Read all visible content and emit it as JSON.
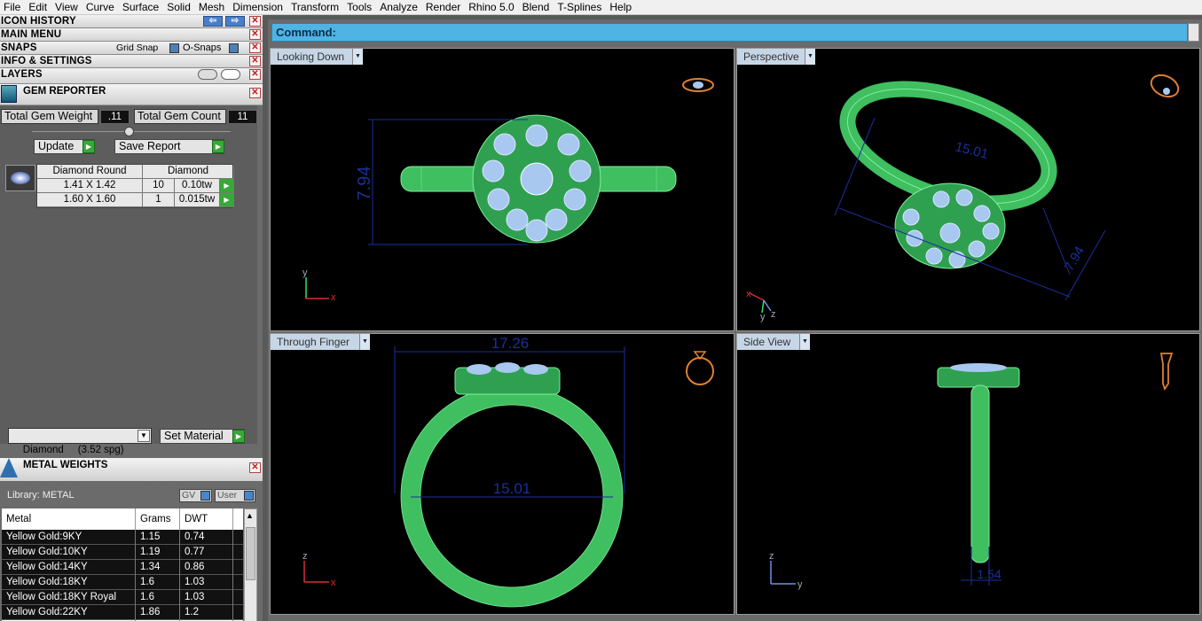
{
  "menu": [
    "File",
    "Edit",
    "View",
    "Curve",
    "Surface",
    "Solid",
    "Mesh",
    "Dimension",
    "Transform",
    "Tools",
    "Analyze",
    "Render",
    "Rhino 5.0",
    "Blend",
    "T-Splines",
    "Help"
  ],
  "panels": {
    "icon_history": "ICON HISTORY",
    "main_menu": "MAIN MENU",
    "snaps": "SNAPS",
    "grid_snap": "Grid Snap",
    "o_snaps": "O-Snaps",
    "info_settings": "INFO & SETTINGS",
    "layers": "LAYERS",
    "close_glyph": "✕",
    "left_arrow": "⇦",
    "right_arrow": "⇨"
  },
  "gem_reporter": {
    "title": "GEM REPORTER",
    "total_weight_label": "Total Gem Weight",
    "total_weight_value": ".11",
    "total_count_label": "Total Gem Count",
    "total_count_value": "11",
    "update_label": "Update",
    "save_report_label": "Save Report",
    "go_glyph": "▶",
    "table": {
      "col1": "Diamond Round",
      "col2": "Diamond",
      "rows": [
        {
          "size": "1.41 X 1.42",
          "count": "10",
          "weight": "0.10tw"
        },
        {
          "size": "1.60 X 1.60",
          "count": "1",
          "weight": "0.015tw"
        }
      ]
    },
    "material_select": "Diamond     (3.52 spg)",
    "set_material_label": "Set Material"
  },
  "metal_weights": {
    "title": "METAL WEIGHTS",
    "library_label": "Library: METAL",
    "gv_label": "GV",
    "user_label": "User",
    "columns": [
      "Metal",
      "Grams",
      "DWT"
    ],
    "rows": [
      {
        "metal": "Yellow Gold:9KY",
        "grams": "1.15",
        "dwt": "0.74"
      },
      {
        "metal": "Yellow Gold:10KY",
        "grams": "1.19",
        "dwt": "0.77"
      },
      {
        "metal": "Yellow Gold:14KY",
        "grams": "1.34",
        "dwt": "0.86"
      },
      {
        "metal": "Yellow Gold:18KY",
        "grams": "1.6",
        "dwt": "1.03"
      },
      {
        "metal": "Yellow Gold:18KY Royal",
        "grams": "1.6",
        "dwt": "1.03"
      },
      {
        "metal": "Yellow Gold:22KY",
        "grams": "1.86",
        "dwt": "1.2"
      }
    ]
  },
  "command": {
    "label": "Command:"
  },
  "viewports": {
    "top": {
      "label": "Looking Down",
      "dim": "7.94",
      "ax1": "y",
      "ax2": "x"
    },
    "persp": {
      "label": "Perspective",
      "dim1": "15.01",
      "dim2": "7.94",
      "ax1": "x",
      "ax2": "y",
      "ax3": "z"
    },
    "front": {
      "label": "Through Finger",
      "dim1": "17.26",
      "dim2": "15.01",
      "ax1": "z",
      "ax2": "x"
    },
    "side": {
      "label": "Side View",
      "dim": "1.54",
      "ax1": "z",
      "ax2": "y"
    }
  },
  "colors": {
    "ring_green": "#3fbf60",
    "gem_blue": "#a8c8f0",
    "dim_blue": "#1a2f9a",
    "cmd_blue": "#4fb4e4"
  }
}
